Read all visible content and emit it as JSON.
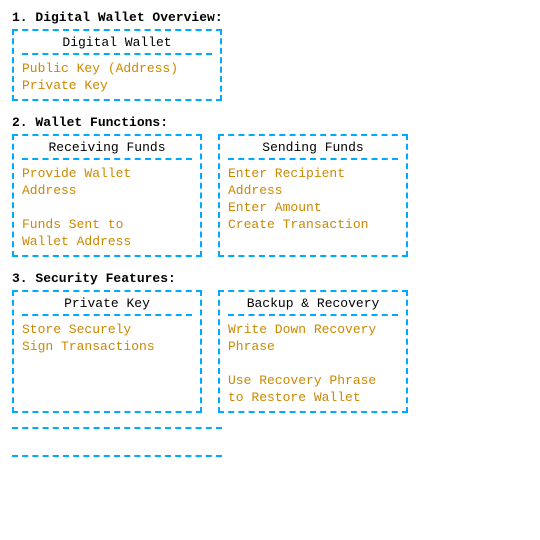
{
  "sections": [
    {
      "id": "section1",
      "title": "1. Digital Wallet Overview:",
      "layout": "single",
      "boxes": [
        {
          "id": "digital-wallet-box",
          "title": "Digital Wallet",
          "lines": [
            "Public Key (Address)",
            "Private Key"
          ]
        }
      ]
    },
    {
      "id": "section2",
      "title": "2. Wallet Functions:",
      "layout": "double",
      "boxes": [
        {
          "id": "receiving-funds-box",
          "title": "Receiving Funds",
          "lines": [
            "Provide Wallet",
            "Address",
            "",
            "Funds Sent to",
            "Wallet Address"
          ]
        },
        {
          "id": "sending-funds-box",
          "title": "Sending Funds",
          "lines": [
            "Enter Recipient",
            "Address",
            "Enter Amount",
            "Create Transaction"
          ]
        }
      ]
    },
    {
      "id": "section3",
      "title": "3. Security Features:",
      "layout": "double",
      "boxes": [
        {
          "id": "private-key-box",
          "title": "Private Key",
          "lines": [
            "Store Securely",
            "Sign Transactions"
          ]
        },
        {
          "id": "backup-recovery-box",
          "title": "Backup & Recovery",
          "lines": [
            "Write Down Recovery",
            "Phrase",
            "",
            "Use Recovery Phrase",
            "to Restore Wallet"
          ]
        }
      ]
    },
    {
      "id": "section4",
      "title": "",
      "layout": "bottom-dashed",
      "boxes": []
    }
  ]
}
